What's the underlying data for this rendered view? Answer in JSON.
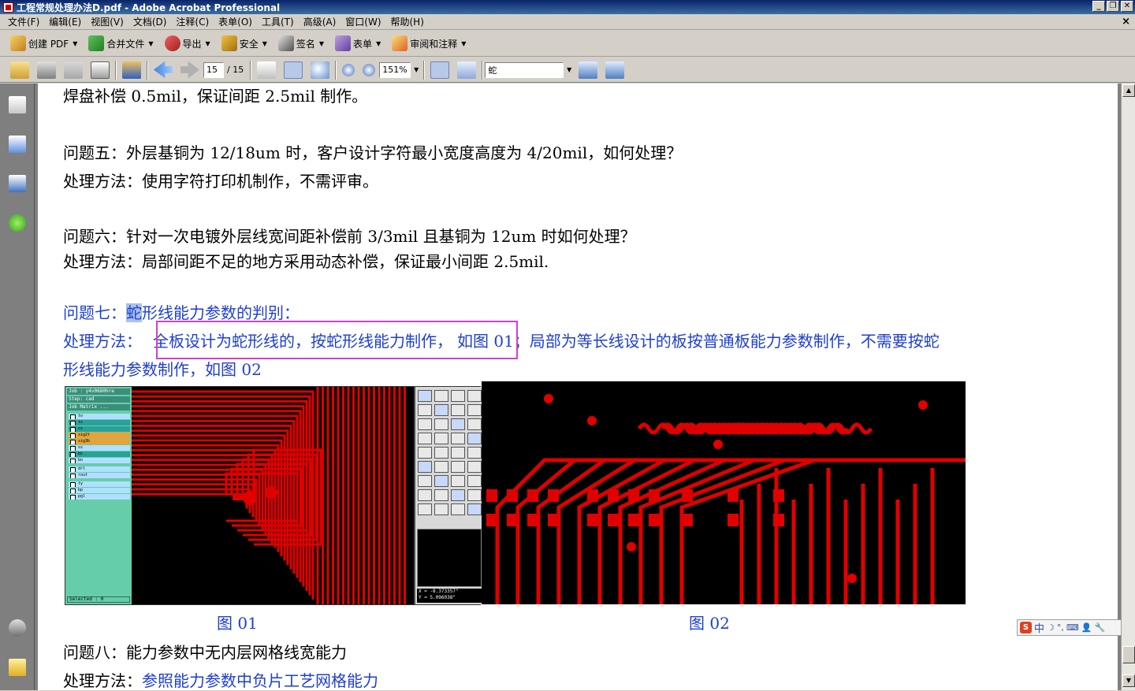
{
  "window": {
    "title": "工程常规处理办法D.pdf - Adobe Acrobat Professional",
    "minimize": "_",
    "restore": "❐",
    "close": "✕",
    "doc_close": "×"
  },
  "menu": [
    "文件(F)",
    "编辑(E)",
    "视图(V)",
    "文档(D)",
    "注释(C)",
    "表单(O)",
    "工具(T)",
    "高级(A)",
    "窗口(W)",
    "帮助(H)"
  ],
  "toolbar": {
    "create_pdf": "创建 PDF",
    "combine": "合并文件",
    "export": "导出",
    "secure": "安全",
    "sign": "签名",
    "forms": "表单",
    "review": "审阅和注释"
  },
  "nav": {
    "page_current": "15",
    "page_total": "/ 15",
    "zoom": "151%",
    "search_value": "蛇"
  },
  "document": {
    "line_top": "焊盘补偿 0.5mil，保证间距 2.5mil 制作。",
    "q5": "问题五：外层基铜为 12/18um 时，客户设计字符最小宽度高度为 4/20mil，如何处理？",
    "a5": "处理方法：使用字符打印机制作，不需评审。",
    "q6": "问题六：针对一次电镀外层线宽间距补偿前 3/3mil 且基铜为 12um 时如何处理？",
    "a6": "处理方法：局部间距不足的地方采用动态补偿，保证最小间距 2.5mil.",
    "q7_prefix": "问题七：",
    "q7_highlight": "蛇",
    "q7_rest": "形线能力参数的判别：",
    "a7_label": "处理方法：",
    "a7_boxed": "全板设计为蛇形线的，按蛇形线能力制作，",
    "a7_rest": "如图 01；局部为等长线设计的板按普通板能力参数制作，不需要按蛇",
    "a7_line2": "形线能力参数制作，如图 02",
    "fig1_caption": "图 01",
    "fig2_caption": "图 02",
    "q8": "问题八：能力参数中无内层网格线宽能力",
    "a8_label": "处理方法：",
    "a8_text": "参照能力参数中负片工艺网格能力"
  },
  "fig1": {
    "header1": "Job : y4v0680hra",
    "header2": "Step: cad",
    "header3": "Job Matrix ...",
    "layers": [
      "to",
      "tc",
      "cs",
      "sig2t",
      "sig3b",
      "ss",
      "bc",
      "bo",
      "drl",
      "rout",
      "ty",
      "bp",
      "pgl"
    ],
    "selected": "Selected : 0",
    "coord_x": "X = -8.373357\"",
    "coord_y": "Y = 5.096038\""
  },
  "ime": {
    "lang": "中",
    "logo": "S",
    "tools": [
      "☽",
      "°,",
      "⌨",
      "👤",
      "🔧"
    ]
  },
  "scrollbar": {
    "up": "▲",
    "down": "▼"
  },
  "colors": {
    "accent_blue": "#1e3fcf",
    "highlight_box": "#d040d0",
    "pcb_trace": "#e00000"
  }
}
